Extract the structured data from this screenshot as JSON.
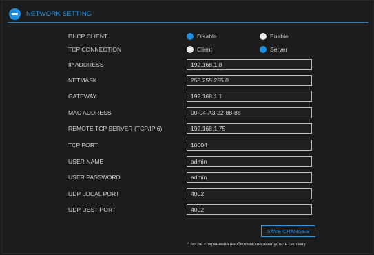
{
  "header": {
    "title": "NETWORK SETTING",
    "icon": "minus-circle-icon",
    "accent_color": "#1e8fe0"
  },
  "dhcp": {
    "label": "DHCP CLIENT",
    "options": [
      {
        "label": "Disable",
        "selected": true
      },
      {
        "label": "Enable",
        "selected": false
      }
    ]
  },
  "tcp_connection": {
    "label": "TCP CONNECTION",
    "options": [
      {
        "label": "Client",
        "selected": false
      },
      {
        "label": "Server",
        "selected": true
      }
    ]
  },
  "fields": [
    {
      "label": "IP ADDRESS",
      "value": "192.168.1.8"
    },
    {
      "label": "NETMASK",
      "value": "255.255.255.0"
    },
    {
      "label": "GATEWAY",
      "value": "192.168.1.1"
    },
    {
      "label": "MAC ADDRESS",
      "value": "00-04-A3-22-88-88"
    },
    {
      "label": "REMOTE TCP SERVER (TCP/IP 6)",
      "value": "192.168.1.75"
    },
    {
      "label": "TCP PORT",
      "value": "10004"
    },
    {
      "label": "USER NAME",
      "value": "admin"
    },
    {
      "label": "USER PASSWORD",
      "value": "admin"
    },
    {
      "label": "UDP LOCAL PORT",
      "value": "4002"
    },
    {
      "label": "UDP DEST PORT",
      "value": "4002"
    }
  ],
  "actions": {
    "save_label": "SAVE CHANGES"
  },
  "footer": {
    "note": "* после сохранения необходимо перезапустить систему"
  }
}
